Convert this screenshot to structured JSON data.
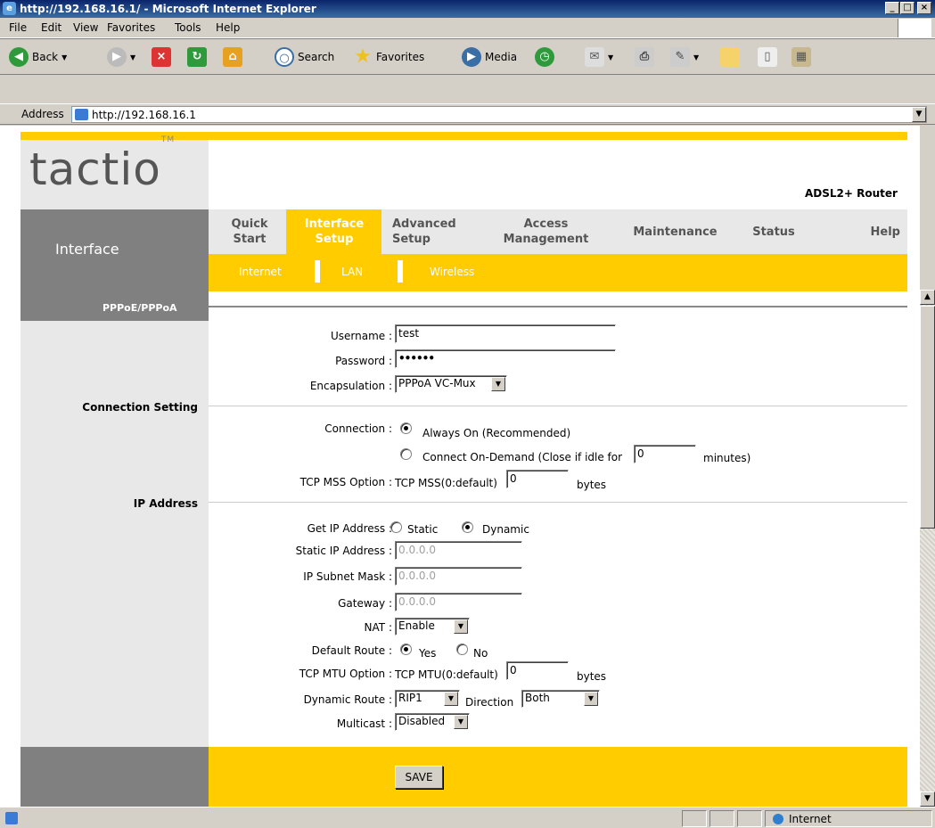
{
  "window": {
    "title": "http://192.168.16.1/ - Microsoft Internet Explorer"
  },
  "menubar": {
    "items": [
      "File",
      "Edit",
      "View",
      "Favorites",
      "Tools",
      "Help"
    ]
  },
  "toolbar": {
    "back": "Back",
    "search": "Search",
    "favorites": "Favorites",
    "media": "Media"
  },
  "address": {
    "label": "Address",
    "url": "http://192.168.16.1"
  },
  "page": {
    "logo_text": "tactio",
    "logo_tm": "TM",
    "product": "ADSL2+ Router",
    "section": "Interface",
    "nav": [
      {
        "line1": "Quick",
        "line2": "Start"
      },
      {
        "line1": "Interface",
        "line2": "Setup"
      },
      {
        "line1": "Advanced",
        "line2": "Setup"
      },
      {
        "line1": "Access",
        "line2": "Management"
      },
      {
        "line1": "Maintenance",
        "line2": ""
      },
      {
        "line1": "Status",
        "line2": ""
      },
      {
        "line1": "Help",
        "line2": ""
      }
    ],
    "subnav": [
      "Internet",
      "LAN",
      "Wireless"
    ],
    "panel_title": "PPPoE/PPPoA",
    "side_connection": "Connection Setting",
    "side_ip": "IP Address",
    "username_label": "Username :",
    "username_value": "test",
    "password_label": "Password :",
    "password_value": "••••••",
    "encap_label": "Encapsulation :",
    "encap_value": "PPPoA VC-Mux",
    "connection_label": "Connection :",
    "always_on": "Always On (Recommended)",
    "on_demand": "Connect On-Demand (Close if idle for",
    "idle_value": "0",
    "minutes": "minutes)",
    "mss_label": "TCP MSS Option :",
    "mss_text": "TCP MSS(0:default)",
    "mss_value": "0",
    "bytes": "bytes",
    "getip_label": "Get IP Address :",
    "static": "Static",
    "dynamic": "Dynamic",
    "static_ip_label": "Static IP Address :",
    "static_ip_value": "0.0.0.0",
    "mask_label": "IP Subnet Mask :",
    "mask_value": "0.0.0.0",
    "gateway_label": "Gateway :",
    "gateway_value": "0.0.0.0",
    "nat_label": "NAT :",
    "nat_value": "Enable",
    "route_label": "Default Route :",
    "yes": "Yes",
    "no": "No",
    "mtu_label": "TCP MTU Option :",
    "mtu_text": "TCP MTU(0:default)",
    "mtu_value": "0",
    "dynroute_label": "Dynamic Route :",
    "dynroute_value": "RIP1",
    "direction_label": "Direction",
    "direction_value": "Both",
    "multicast_label": "Multicast :",
    "multicast_value": "Disabled",
    "save": "SAVE"
  },
  "statusbar": {
    "zone": "Internet"
  }
}
